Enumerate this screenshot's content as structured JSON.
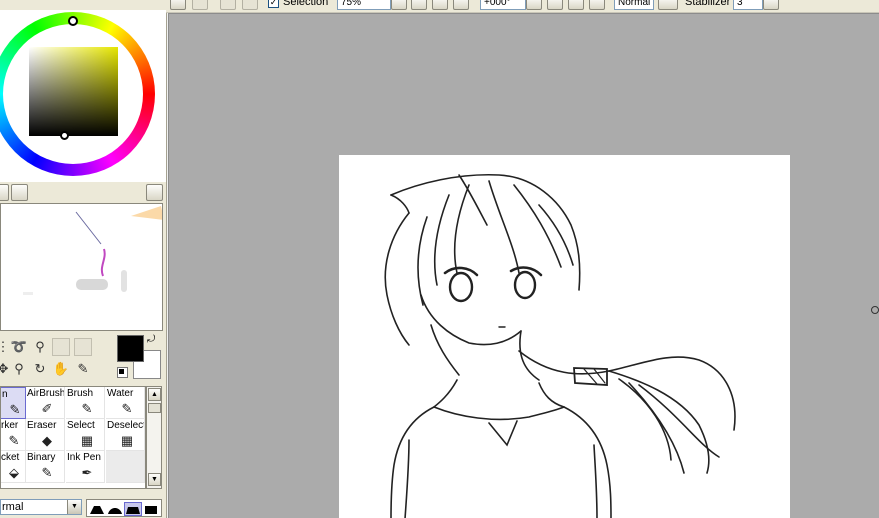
{
  "toolbar": {
    "selection_label": "Selection",
    "selection_checked": "✓",
    "zoom_value": "75%",
    "rotation_value": "+000°",
    "blend_value": "Normal",
    "stabilizer_label": "Stabilizer",
    "stabilizer_value": "3"
  },
  "color_picker": {
    "hue_color": "#e6e600",
    "current_color": "#000000"
  },
  "tool_icons": [
    "selection-marquee-icon",
    "lasso-icon",
    "magic-wand-icon",
    "move-icon",
    "zoom-icon",
    "rotate-icon",
    "hand-icon",
    "eyedropper-icon"
  ],
  "brushes": [
    {
      "label": "n",
      "icon": "pen-icon"
    },
    {
      "label": "AirBrush",
      "icon": "airbrush-icon"
    },
    {
      "label": "Brush",
      "icon": "brush-icon"
    },
    {
      "label": "Water",
      "icon": "water-icon"
    },
    {
      "label": "rker",
      "icon": "marker-icon"
    },
    {
      "label": "Eraser",
      "icon": "eraser-icon"
    },
    {
      "label": "Select",
      "icon": "select-icon"
    },
    {
      "label": "Deselect",
      "icon": "deselect-icon"
    },
    {
      "label": "cket",
      "icon": "bucket-icon"
    },
    {
      "label": "Binary",
      "icon": "binary-icon"
    },
    {
      "label": "Ink Pen",
      "icon": "ink-pen-icon"
    },
    {
      "label": "",
      "icon": ""
    }
  ],
  "blend_mode": "rmal",
  "colors": {
    "panel_bg": "#ece9d8",
    "canvas_bg": "#ababab",
    "paper": "#ffffff",
    "selected_brush": "#dcdcf4"
  }
}
